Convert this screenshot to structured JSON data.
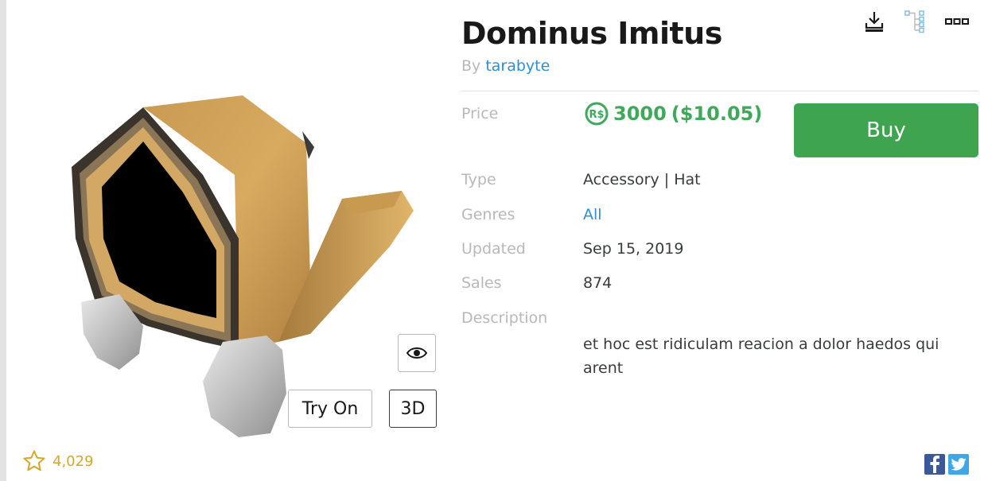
{
  "item": {
    "title": "Dominus Imitus",
    "by_prefix": "By ",
    "creator": "tarabyte"
  },
  "price": {
    "label": "Price",
    "currency_symbol": "R$",
    "value": "3000",
    "usd": "($10.05)",
    "buy_label": "Buy"
  },
  "details": {
    "type_label": "Type",
    "type_value": "Accessory | Hat",
    "genres_label": "Genres",
    "genres_value": "All",
    "updated_label": "Updated",
    "updated_value": "Sep 15, 2019",
    "sales_label": "Sales",
    "sales_value": "874",
    "description_label": "Description",
    "description_value": "et hoc est ridiculam reacion a dolor haedos qui arent"
  },
  "preview": {
    "try_on_label": "Try On",
    "three_d_label": "3D"
  },
  "favorites": {
    "count": "4,029"
  },
  "icons": {
    "download": "download-icon",
    "hierarchy": "hierarchy-icon",
    "more": "more-icon",
    "eye": "eye-icon",
    "star": "star-icon",
    "facebook": "facebook-icon",
    "twitter": "twitter-icon"
  },
  "colors": {
    "price_green": "#3fa95a",
    "buy_green": "#3ea450",
    "link_blue": "#2b8ede",
    "star_gold": "#d4a82b"
  }
}
